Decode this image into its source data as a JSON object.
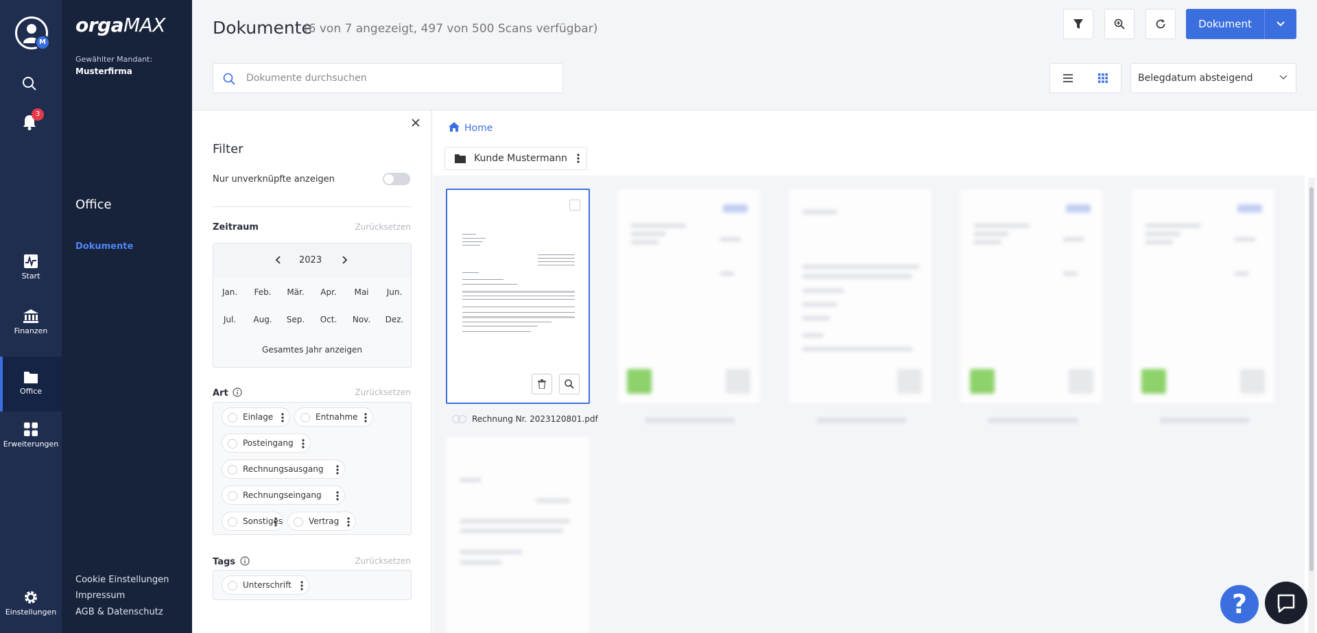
{
  "rail": {
    "avatar_badge": "M",
    "notifications_count": "3",
    "items": [
      {
        "label": "Start"
      },
      {
        "label": "Finanzen"
      },
      {
        "label": "Office"
      },
      {
        "label": "Erweiterungen"
      }
    ],
    "settings_label": "Einstellungen"
  },
  "sidebar": {
    "logo_orga": "orga",
    "logo_max": "MAX",
    "mandant_label": "Gewählter Mandant:",
    "mandant_value": "Musterfirma",
    "section_title": "Office",
    "sub_item": "Dokumente",
    "footer_links": [
      "Cookie Einstellungen",
      "Impressum",
      "AGB & Datenschutz"
    ]
  },
  "header": {
    "title": "Dokumente",
    "subtitle": "(6 von 7 angezeigt, 497 von 500 Scans verfügbar)",
    "document_button": "Dokument",
    "search_placeholder": "Dokumente durchsuchen",
    "sort_value": "Belegdatum absteigend"
  },
  "filter": {
    "title": "Filter",
    "unlinked_label": "Nur unverknüpfte anzeigen",
    "zeitraum_label": "Zeitraum",
    "reset_label": "Zurücksetzen",
    "year": "2023",
    "months": [
      "Jan.",
      "Feb.",
      "Mär.",
      "Apr.",
      "Mai",
      "Jun.",
      "Jul.",
      "Aug.",
      "Sep.",
      "Oct.",
      "Nov.",
      "Dez."
    ],
    "whole_year": "Gesamtes Jahr anzeigen",
    "art_label": "Art",
    "art_chips": [
      "Einlage",
      "Entnahme",
      "Posteingang",
      "Rechnungsausgang",
      "Rechnungseingang",
      "Sonstiges",
      "Vertrag"
    ],
    "tags_label": "Tags",
    "tag_chips": [
      "Unterschrift"
    ]
  },
  "documents": {
    "breadcrumb_home": "Home",
    "folder_name": "Kunde Mustermann",
    "selected_file": "Rechnung Nr. 2023120801.pdf"
  },
  "colors": {
    "accent": "#3b6fe0",
    "rail_bg": "#1f2d4f",
    "sidebar_bg": "#17223b",
    "badge": "#e8394a"
  }
}
